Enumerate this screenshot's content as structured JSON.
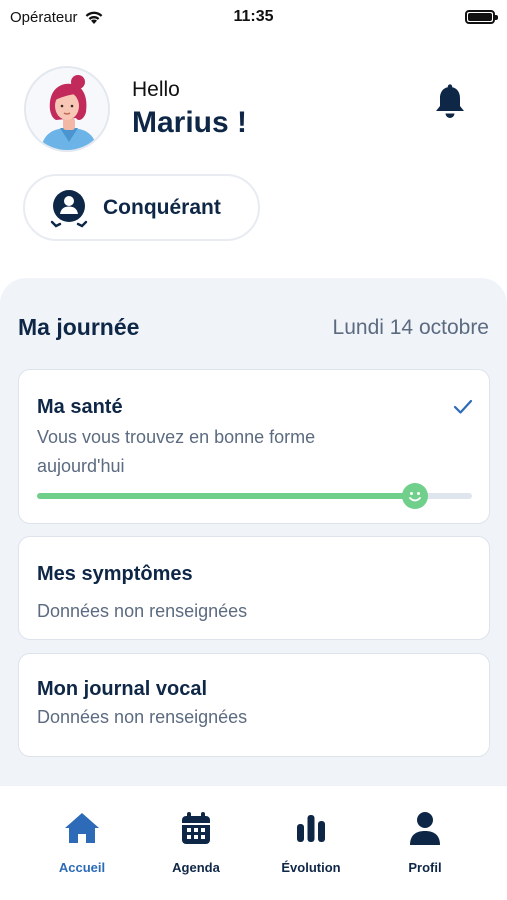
{
  "status_bar": {
    "carrier": "Opérateur",
    "time": "11:35",
    "icons": [
      "wifi-icon",
      "battery-icon"
    ]
  },
  "header": {
    "greeting": "Hello",
    "user_name": "Marius !",
    "icons": [
      "avatar",
      "bell-icon"
    ]
  },
  "badge": {
    "label": "Conquérant",
    "icon": "user-badge-icon"
  },
  "day": {
    "title": "Ma journée",
    "date": "Lundi 14 octobre"
  },
  "cards": {
    "health": {
      "title": "Ma santé",
      "text": "Vous vous trouvez en bonne forme aujourd'hui",
      "completed": true,
      "level_percent": 87
    },
    "symptoms": {
      "title": "Mes symptômes",
      "text": "Données non renseignées"
    },
    "voice": {
      "title": "Mon journal vocal",
      "text": "Données non renseignées"
    }
  },
  "nav": {
    "items": [
      {
        "label": "Accueil",
        "icon": "home-icon",
        "active": true
      },
      {
        "label": "Agenda",
        "icon": "calendar-icon",
        "active": false
      },
      {
        "label": "Évolution",
        "icon": "bar-chart-icon",
        "active": false
      },
      {
        "label": "Profil",
        "icon": "person-icon",
        "active": false
      }
    ]
  },
  "colors": {
    "primary": "#0f2747",
    "accent_blue": "#2d6bb8",
    "success_green": "#6fcf8b",
    "panel_bg": "#f0f4f9",
    "muted_text": "#5c6b80"
  }
}
